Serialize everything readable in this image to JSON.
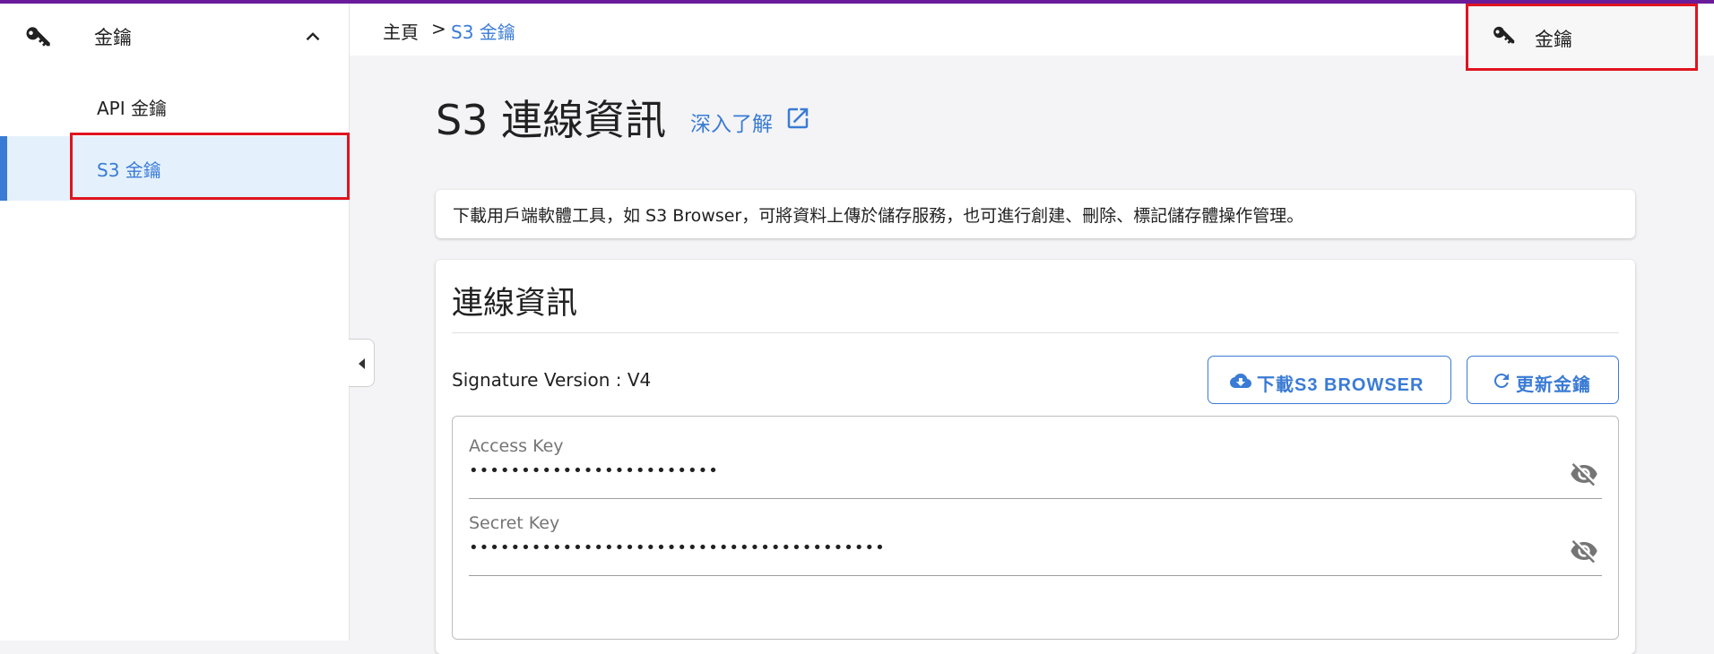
{
  "sidebar": {
    "title": "金鑰",
    "items": [
      {
        "label": "API 金鑰"
      },
      {
        "label": "S3 金鑰"
      }
    ]
  },
  "breadcrumb": {
    "home": "主頁",
    "separator": ">",
    "current": "S3 金鑰"
  },
  "top_menu": {
    "label": "金鑰"
  },
  "page": {
    "title": "S3 連線資訊",
    "learn_more": "深入了解"
  },
  "banner": {
    "text": "下載用戶端軟體工具，如 S3 Browser，可將資料上傳於儲存服務，也可進行創建、刪除、標記儲存體操作管理。"
  },
  "card": {
    "title": "連線資訊",
    "signature": "Signature Version : V4",
    "download_label": "下載S3 BROWSER",
    "refresh_label": "更新金鑰",
    "fields": [
      {
        "label": "Access Key",
        "value": "••••••••••••••••••••••••"
      },
      {
        "label": "Secret Key",
        "value": "••••••••••••••••••••••••••••••••••••••••"
      }
    ]
  },
  "colors": {
    "accent": "#3a7bd5",
    "top_bar": "#6a1b9a",
    "highlight": "#e0141e",
    "active_bg": "#e4f1fc"
  },
  "icons": [
    "key-icon",
    "chevron-up-icon",
    "external-link-icon",
    "cloud-download-icon",
    "refresh-icon",
    "eye-off-icon",
    "caret-left-icon"
  ]
}
